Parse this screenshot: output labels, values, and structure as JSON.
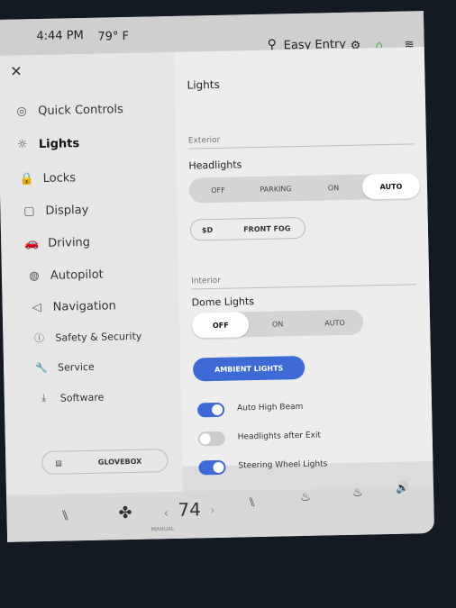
{
  "status": {
    "time": "4:44 PM",
    "temp": "79° F",
    "profile": "Easy Entry",
    "icons": [
      "person-icon",
      "gear-icon",
      "home-icon",
      "wifi-icon",
      "bluetooth-icon"
    ],
    "home_color": "#3cb043"
  },
  "panel": {
    "title": "Lights",
    "close": "✕"
  },
  "sidebar": {
    "items": [
      {
        "label": "Quick Controls",
        "icon": "◎"
      },
      {
        "label": "Lights",
        "icon": "☼",
        "active": true
      },
      {
        "label": "Locks",
        "icon": "🔒"
      },
      {
        "label": "Display",
        "icon": "▢"
      },
      {
        "label": "Driving",
        "icon": "🚗"
      },
      {
        "label": "Autopilot",
        "icon": "◍"
      },
      {
        "label": "Navigation",
        "icon": "◁"
      },
      {
        "label": "Safety & Security",
        "icon": "ⓘ"
      },
      {
        "label": "Service",
        "icon": "🔧"
      },
      {
        "label": "Software",
        "icon": "⤓"
      }
    ],
    "glovebox": "GLOVEBOX"
  },
  "exterior": {
    "section": "Exterior",
    "headlights_label": "Headlights",
    "headlights_options": [
      "OFF",
      "PARKING",
      "ON",
      "AUTO"
    ],
    "headlights_selected": "AUTO",
    "front_fog": "FRONT FOG",
    "fog_icon": "$D"
  },
  "interior": {
    "section": "Interior",
    "dome_label": "Dome Lights",
    "dome_options": [
      "OFF",
      "ON",
      "AUTO"
    ],
    "dome_selected": "OFF",
    "ambient": "AMBIENT LIGHTS"
  },
  "toggles": [
    {
      "label": "Auto High Beam",
      "on": true
    },
    {
      "label": "Headlights after Exit",
      "on": false
    },
    {
      "label": "Steering Wheel Lights",
      "on": true
    }
  ],
  "accent": "#3e6ad5",
  "bottom": {
    "temp": "74",
    "mode": "MANUAL",
    "left": "‹",
    "right": "›"
  }
}
